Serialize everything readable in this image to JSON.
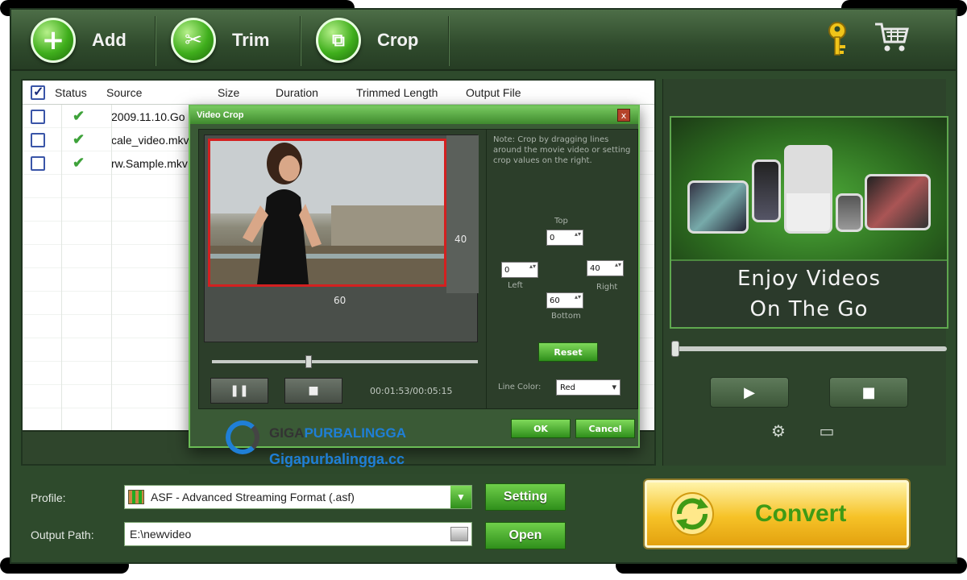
{
  "toolbar": {
    "add_label": "Add",
    "trim_label": "Trim",
    "crop_label": "Crop",
    "key_icon": "key-icon",
    "cart_icon": "cart-icon"
  },
  "file_list": {
    "columns": [
      "Status",
      "Source",
      "Size",
      "Duration",
      "Trimmed Length",
      "Output File"
    ],
    "rows": [
      {
        "status": "✔",
        "source": "2009.11.10.Go"
      },
      {
        "status": "✔",
        "source": "cale_video.mkv"
      },
      {
        "status": "✔",
        "source": "rw.Sample.mkv"
      }
    ]
  },
  "promo": {
    "line1": "Enjoy Videos",
    "line2": "On The Go"
  },
  "profile": {
    "label": "Profile:",
    "value": "ASF - Advanced Streaming Format (.asf)",
    "setting_label": "Setting"
  },
  "output": {
    "label": "Output Path:",
    "value": "E:\\newvideo",
    "open_label": "Open"
  },
  "convert": {
    "label": "Convert"
  },
  "dialog": {
    "title": "Video Crop",
    "close_glyph": "x",
    "note": "Note: Crop by dragging lines around the movie video or setting crop values on the right.",
    "height_label": "40",
    "width_label": "60",
    "pause_glyph": "❚❚",
    "stop_glyph": "■",
    "timecode": "00:01:53/00:05:15",
    "top_label": "Top",
    "top_value": "0",
    "left_label": "Left",
    "left_value": "0",
    "right_label": "Right",
    "right_value": "40",
    "bottom_label": "Bottom",
    "bottom_value": "60",
    "reset_label": "Reset",
    "line_color_label": "Line Color:",
    "line_color_value": "Red",
    "ok_label": "OK",
    "cancel_label": "Cancel"
  },
  "player": {
    "play_glyph": "▶",
    "stop_glyph": "■"
  },
  "watermark": {
    "brand_part1": "GIGA",
    "brand_part2": "PURBALINGGA",
    "url": "Gigapurbalingga.cc"
  }
}
